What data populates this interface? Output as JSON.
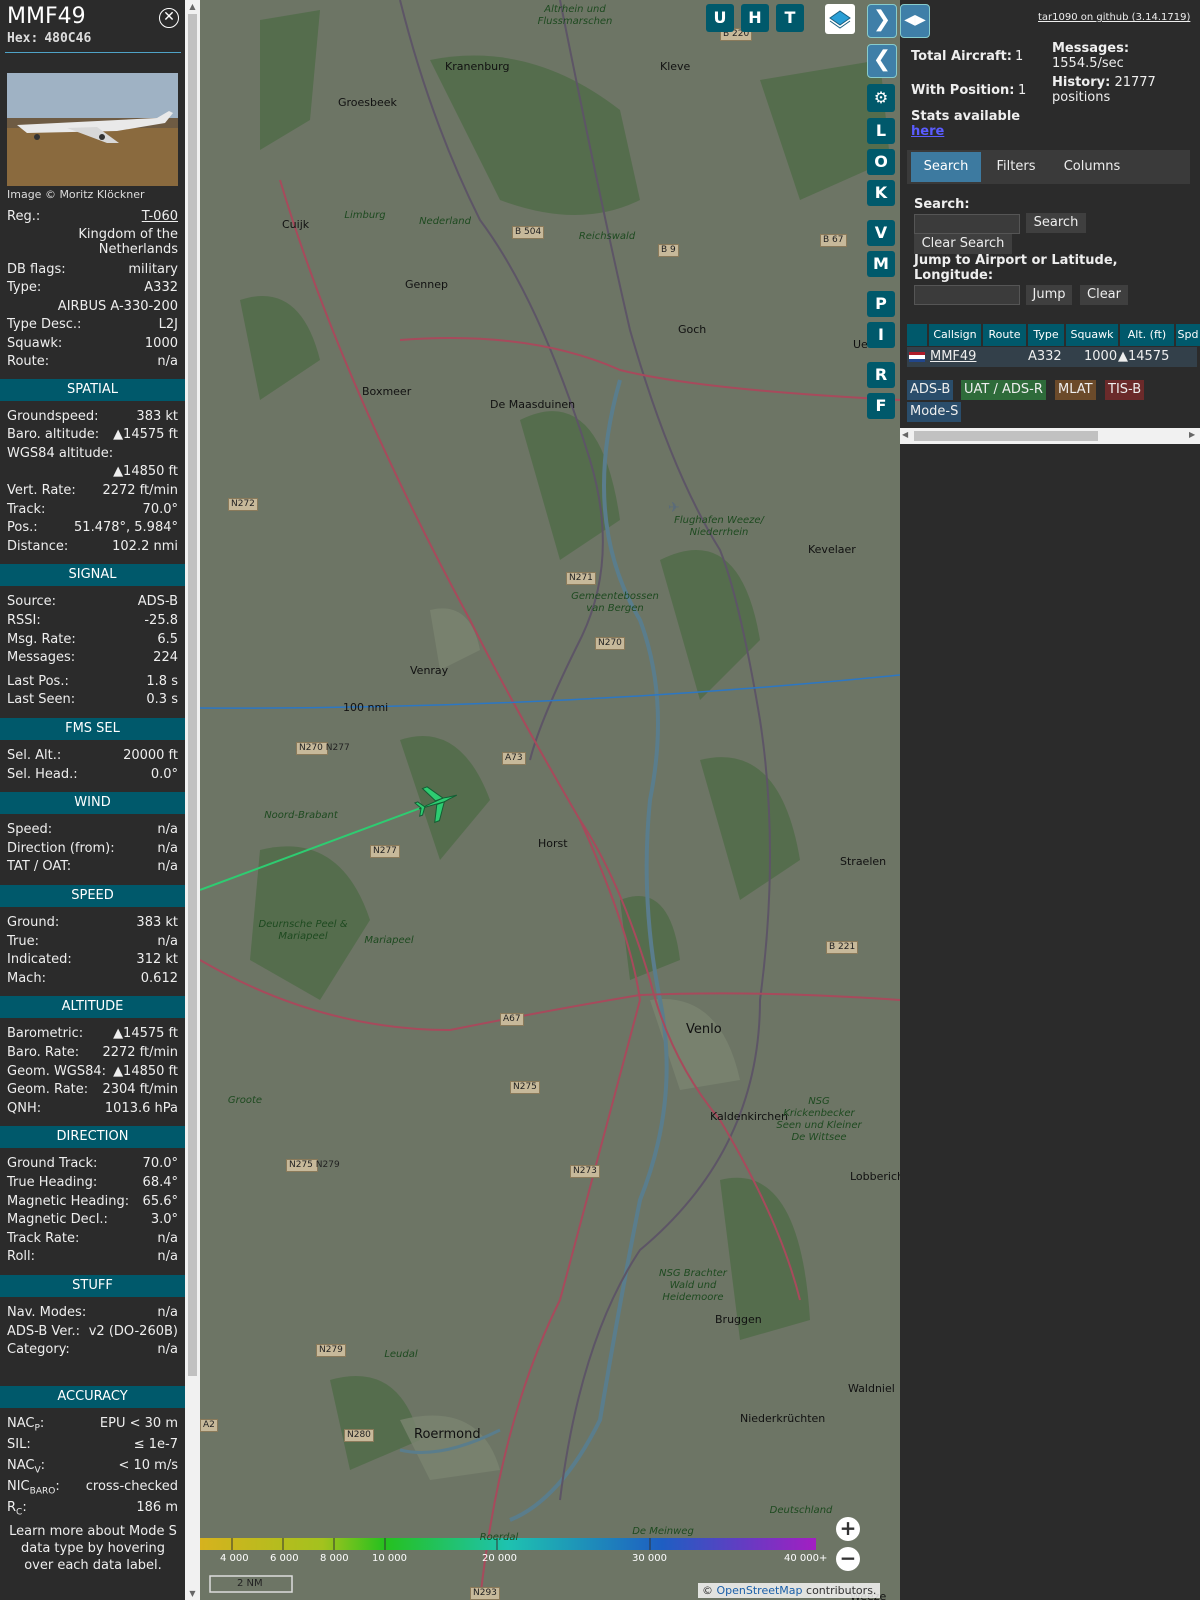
{
  "info": {
    "callsign": "MMF49",
    "hex_label": "Hex:",
    "hex": "480C46",
    "photo_credit": "Image © Moritz Klöckner",
    "summary": [
      {
        "key": "Reg.:",
        "value": "T-060"
      },
      {
        "key": "",
        "value": "Kingdom of the Netherlands"
      },
      {
        "key": "DB flags:",
        "value": "military"
      },
      {
        "key": "Type:",
        "value": "A332"
      },
      {
        "key": "",
        "value": "AIRBUS A-330-200"
      },
      {
        "key": "Type Desc.:",
        "value": "L2J"
      },
      {
        "key": "Squawk:",
        "value": "1000"
      },
      {
        "key": "Route:",
        "value": "n/a"
      }
    ],
    "sections": [
      {
        "title": "SPATIAL",
        "rows": [
          {
            "key": "Groundspeed:",
            "value": "383 kt"
          },
          {
            "key": "Baro. altitude:",
            "value": "▲14575 ft"
          },
          {
            "key": "WGS84 altitude:",
            "value": ""
          },
          {
            "key": "",
            "value": "▲14850 ft"
          },
          {
            "key": "Vert. Rate:",
            "value": "2272 ft/min"
          },
          {
            "key": "Track:",
            "value": "70.0°"
          },
          {
            "key": "Pos.:",
            "value": "51.478°, 5.984°"
          },
          {
            "key": "Distance:",
            "value": "102.2 nmi"
          }
        ]
      },
      {
        "title": "SIGNAL",
        "rows": [
          {
            "key": "Source:",
            "value": "ADS-B"
          },
          {
            "key": "RSSI:",
            "value": "-25.8"
          },
          {
            "key": "Msg. Rate:",
            "value": "6.5"
          },
          {
            "key": "Messages:",
            "value": "224"
          },
          {
            "key": "Last Pos.:",
            "value": "1.8 s"
          },
          {
            "key": "Last Seen:",
            "value": "0.3 s"
          }
        ]
      },
      {
        "title": "FMS SEL",
        "rows": [
          {
            "key": "Sel. Alt.:",
            "value": "20000 ft"
          },
          {
            "key": "Sel. Head.:",
            "value": "0.0°"
          }
        ]
      },
      {
        "title": "WIND",
        "rows": [
          {
            "key": "Speed:",
            "value": "n/a"
          },
          {
            "key": "Direction (from):",
            "value": "n/a"
          },
          {
            "key": "TAT / OAT:",
            "value": "n/a"
          }
        ]
      },
      {
        "title": "SPEED",
        "rows": [
          {
            "key": "Ground:",
            "value": "383 kt"
          },
          {
            "key": "True:",
            "value": "n/a"
          },
          {
            "key": "Indicated:",
            "value": "312 kt"
          },
          {
            "key": "Mach:",
            "value": "0.612"
          }
        ]
      },
      {
        "title": "ALTITUDE",
        "rows": [
          {
            "key": "Barometric:",
            "value": "▲14575 ft"
          },
          {
            "key": "Baro. Rate:",
            "value": "2272 ft/min"
          },
          {
            "key": "Geom. WGS84:",
            "value": "▲14850 ft"
          },
          {
            "key": "Geom. Rate:",
            "value": "2304 ft/min"
          },
          {
            "key": "QNH:",
            "value": "1013.6 hPa"
          }
        ]
      },
      {
        "title": "DIRECTION",
        "rows": [
          {
            "key": "Ground Track:",
            "value": "70.0°"
          },
          {
            "key": "True Heading:",
            "value": "68.4°"
          },
          {
            "key": "Magnetic Heading:",
            "value": "65.6°"
          },
          {
            "key": "Magnetic Decl.:",
            "value": "3.0°"
          },
          {
            "key": "Track Rate:",
            "value": "n/a"
          },
          {
            "key": "Roll:",
            "value": "n/a"
          }
        ]
      },
      {
        "title": "STUFF",
        "rows": [
          {
            "key": "Nav. Modes:",
            "value": "n/a"
          },
          {
            "key": "ADS-B Ver.:",
            "value": "v2 (DO-260B)"
          },
          {
            "key": "Category:",
            "value": "n/a"
          }
        ]
      },
      {
        "title": "ACCURACY",
        "rows": [
          {
            "key": "NACP:",
            "value": "EPU < 30 m"
          },
          {
            "key": "SIL:",
            "value": "≤ 1e-7"
          },
          {
            "key": "NACV:",
            "value": "< 10 m/s"
          },
          {
            "key": "NICBARO:",
            "value": "cross-checked"
          },
          {
            "key": "RC:",
            "value": "186 m"
          }
        ]
      }
    ],
    "footer_note": "Learn more about Mode S data type by hovering over each data label."
  },
  "map": {
    "toolbar_buttons": [
      "U",
      "H",
      "T"
    ],
    "side_buttons": [
      "L",
      "O",
      "K",
      "V",
      "M",
      "P",
      "I",
      "R",
      "F"
    ],
    "range_ring_label": "100 nmi",
    "places": [
      "Kranenburg",
      "Kleve",
      "Groesbeek",
      "Cuijk",
      "Gennep",
      "Goch",
      "Boxmeer",
      "De Maasduinen",
      "Kevelaer",
      "Venray",
      "Horst",
      "Venlo",
      "Straelen",
      "Kaldenkirchen",
      "Bruggen",
      "Waldniel",
      "Niederkrüchten",
      "Roermond",
      "Uedem",
      "Lobberich",
      "Weeze"
    ],
    "road_labels": [
      "B 220",
      "B 504",
      "B 9",
      "B 67",
      "N272",
      "N271",
      "N270",
      "A73",
      "N270 N277",
      "N277",
      "A67",
      "N275",
      "N273",
      "N275 N279",
      "N279",
      "N280",
      "A2",
      "N293",
      "B 221"
    ],
    "area_labels": [
      "Altrhein und Flussmarschen",
      "Reichswald",
      "Flughafen Weeze/ Niederrhein",
      "Gemeentebossen van Bergen",
      "Deurnsche Peel & Mariapeel",
      "Mariapeel",
      "Groote",
      "Leudal",
      "Roerdal",
      "NSG Brachter Wald und Heidemoore",
      "NSG Krickenbecker Seen und Kleiner De Wittsee",
      "De Meinweg",
      "Noord-Brabant",
      "Limburg",
      "Deutschland",
      "Nederland"
    ],
    "altitude_scale_labels": [
      "4 000",
      "6 000",
      "8 000",
      "10 000",
      "20 000",
      "30 000",
      "40 000+"
    ],
    "distance_scale": "2 NM",
    "attribution_prefix": "© ",
    "attribution_link": "OpenStreetMap",
    "attribution_suffix": " contributors."
  },
  "right": {
    "github_link": "tar1090 on github (3.14.1719)",
    "total_aircraft_label": "Total Aircraft:",
    "total_aircraft": "1",
    "with_position_label": "With Position:",
    "with_position": "1",
    "messages_label": "Messages:",
    "messages_rate": "1554.5/sec",
    "history_label": "History:",
    "history_value": "21777 positions",
    "stats_text": "Stats available",
    "stats_link": "here",
    "tabs": [
      "Search",
      "Filters",
      "Columns"
    ],
    "search_label": "Search:",
    "search_button": "Search",
    "clear_search_button": "Clear Search",
    "jump_label": "Jump to Airport or Latitude, Longitude:",
    "jump_button": "Jump",
    "clear_button": "Clear",
    "table_headers": [
      "Callsign",
      "Route",
      "Type",
      "Squawk",
      "Alt. (ft)",
      "Spd"
    ],
    "table_rows": [
      {
        "callsign": "MMF49",
        "route": "",
        "type": "A332",
        "squawk": "1000",
        "alt": "▲14575"
      }
    ],
    "source_badges": [
      {
        "label": "ADS-B",
        "color": "#2a4d6b"
      },
      {
        "label": "UAT / ADS-R",
        "color": "#2e6b3a"
      },
      {
        "label": "MLAT",
        "color": "#6b4a2a"
      },
      {
        "label": "TIS-B",
        "color": "#6b2a2a"
      },
      {
        "label": "Mode-S",
        "color": "#2a4d6b"
      }
    ]
  },
  "colors": {
    "section_header": "#00596b",
    "panel_bg": "#2b2b2b",
    "accent_blue": "#3d7aa0",
    "aircraft": "#2ecc71"
  }
}
